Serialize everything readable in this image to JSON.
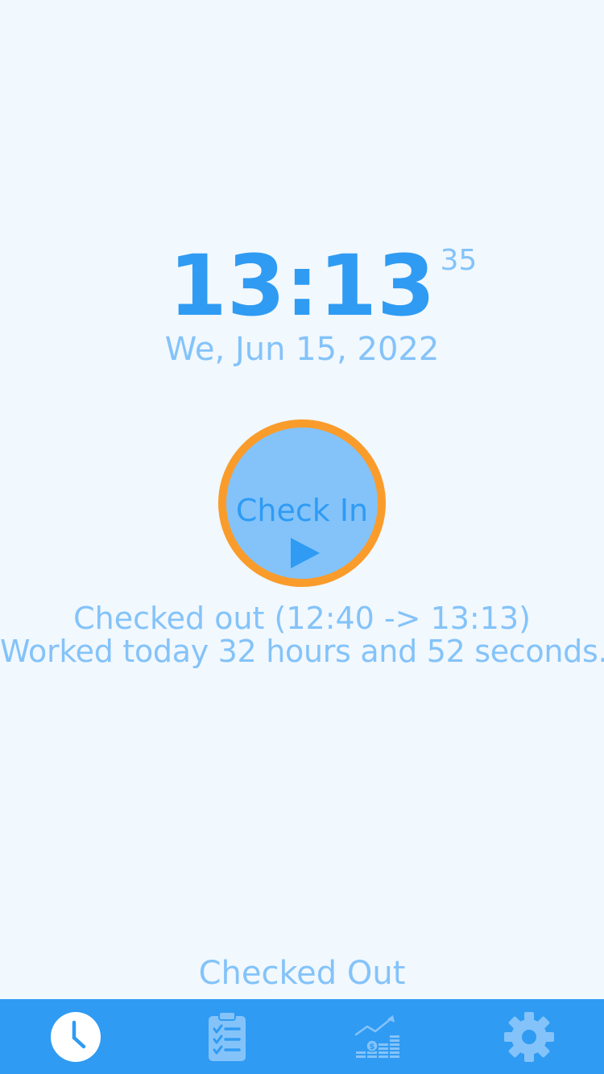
{
  "clock": {
    "time": "13:13",
    "seconds": "35",
    "date": "We, Jun 15, 2022"
  },
  "check_button": {
    "label": "Check In",
    "icon": "play-icon"
  },
  "status": {
    "line1": "Checked out (12:40 -> 13:13)",
    "line2": "Worked today 32 hours and 52 seconds."
  },
  "footer_status": "Checked Out",
  "tabs": [
    {
      "icon": "clock-icon",
      "active": true
    },
    {
      "icon": "clipboard-checklist-icon",
      "active": false
    },
    {
      "icon": "earnings-chart-icon",
      "active": false
    },
    {
      "icon": "gear-icon",
      "active": false
    }
  ],
  "colors": {
    "background": "#f1f8fe",
    "primary": "#2f9bf3",
    "light": "#84c3f9",
    "button_fill": "#83c3fa",
    "button_ring": "#fa9c2b",
    "tabbar": "#2f9bf3"
  }
}
